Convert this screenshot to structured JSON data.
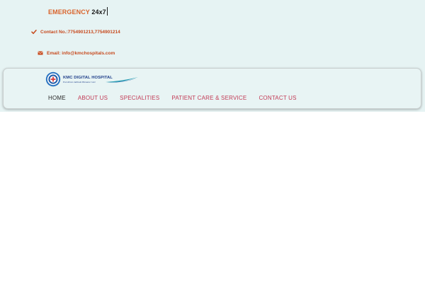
{
  "header": {
    "emergency_word": "EMERGENCY",
    "emergency_hours": "24x7",
    "phone_icon": "check-icon",
    "phone_text": "Contact No.:7754901213,7754901214",
    "email_icon": "envelope-icon",
    "email_text": "Email: info@kmchospitals.com"
  },
  "logo": {
    "name": "KMC DIGITAL HOSPITAL",
    "tagline": "Excellence  Attitude  Humane  Care"
  },
  "nav": {
    "items": [
      {
        "label": "HOME",
        "active": true
      },
      {
        "label": "ABOUT US",
        "active": false
      },
      {
        "label": "SPECIALITIES",
        "active": false
      },
      {
        "label": "PATIENT CARE & SERVICE",
        "active": false
      },
      {
        "label": "CONTACT US",
        "active": false
      }
    ]
  },
  "colors": {
    "accent_orange": "#d9642c",
    "nav_link": "#c23a55",
    "header_bg": "#e6f3f3",
    "logo_blue": "#1f3f8a"
  }
}
